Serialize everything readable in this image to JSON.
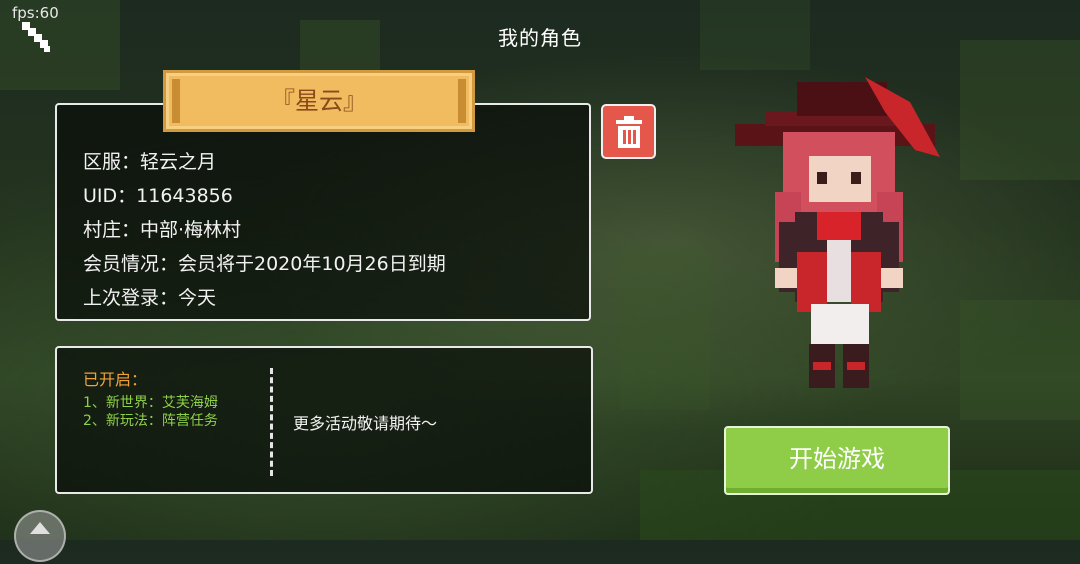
{
  "status": {
    "fps": "fps:60"
  },
  "header": {
    "title": "我的角色"
  },
  "character": {
    "name": "『星云』",
    "info": {
      "server": "区服：轻云之月",
      "uid": "UID：11643856",
      "village": "村庄：中部·梅林村",
      "membership": "会员情况：会员将于2020年10月26日到期",
      "last_login": "上次登录：今天"
    }
  },
  "events": {
    "opened_title": "已开启：",
    "items": [
      "1、新世界：艾芙海姆",
      "2、新玩法：阵营任务"
    ],
    "more": "更多活动敬请期待～"
  },
  "actions": {
    "start_label": "开始游戏"
  },
  "icons": {
    "back": "back-arrow-icon",
    "delete": "trash-icon",
    "corner": "joystick-icon"
  },
  "colors": {
    "banner": "#f1bb5f",
    "delete": "#e4574a",
    "start": "#8fcd48",
    "opened_title": "#f0a23a",
    "opened_items": "#8fd04a"
  }
}
